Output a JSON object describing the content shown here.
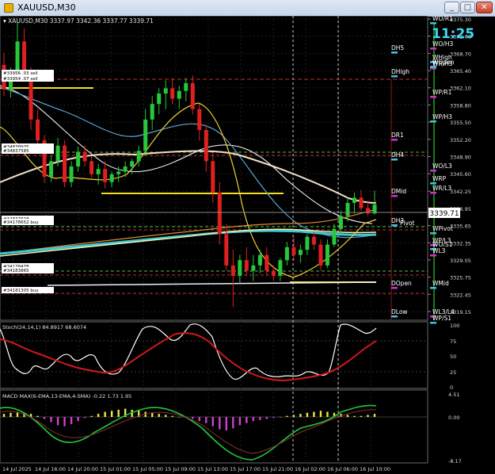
{
  "window": {
    "title": "XAUUSD,M30"
  },
  "header": {
    "symbol": "XAUUSD,M30",
    "ohlc": "3337.97 3342.36 3337.77 3339.71"
  },
  "clock": "11:25",
  "current_price": "3339.71",
  "price_axis": [
    "3375.30",
    "3372.00",
    "3368.70",
    "3365.40",
    "3362.10",
    "3358.80",
    "3355.50",
    "3352.20",
    "3348.90",
    "3345.60",
    "3342.25",
    "3338.95",
    "3335.65",
    "3332.35",
    "3329.05",
    "3325.75",
    "3322.45",
    "3319.15"
  ],
  "pivot_labels": [
    "DH5",
    "DHigh",
    "DR1",
    "DH4",
    "DMid",
    "DH3",
    "DOpen",
    "DLow",
    "Pivot"
  ],
  "weekly_labels": [
    "WO/R1",
    "WO/H3",
    "WHigh",
    "WR/H3",
    "WOpen",
    "WP/R1",
    "WP/H3",
    "WO/L3",
    "WRP",
    "WR/L3",
    "WPivot",
    "WP/L3",
    "WO/S1",
    "WL3",
    "WMid",
    "WL3/L4",
    "WP/S1"
  ],
  "order_tags": [
    "#33956 .03 sell",
    "#33954 .07 sell",
    "#34838935",
    "#34837585",
    "#34837608",
    "#34178652 buy",
    "#34178478",
    "#34183865",
    "#34181305 buy"
  ],
  "stoch": {
    "label": "Stoch(24,14,1) 84.8917 68.6074",
    "levels": [
      "100",
      "75",
      "50",
      "25",
      "0"
    ]
  },
  "macd": {
    "label": "MACD MAX(6-EMA,13-EMA,4-SMA) -0.22 1.73 1.95",
    "levels": [
      "4.51",
      "0.00",
      "-8.17"
    ]
  },
  "time_axis": [
    "14 Jul 2025",
    "14 Jul 16:00",
    "14 Jul 20:00",
    "15 Jul 01:00",
    "15 Jul 05:00",
    "15 Jul 09:00",
    "15 Jul 13:00",
    "15 Jul 17:00",
    "15 Jul 21:00",
    "16 Jul 02:00",
    "16 Jul 06:00",
    "16 Jul 10:00"
  ],
  "candles": [
    [
      3366.5,
      3368.8,
      3360.5,
      3361.8
    ],
    [
      3361.8,
      3366.0,
      3360.2,
      3365.0
    ],
    [
      3365.0,
      3374.8,
      3363.5,
      3371.0
    ],
    [
      3371.0,
      3373.5,
      3364.0,
      3365.0
    ],
    [
      3365.0,
      3366.0,
      3354.0,
      3356.0
    ],
    [
      3356.0,
      3358.0,
      3350.8,
      3352.0
    ],
    [
      3352.0,
      3353.0,
      3343.8,
      3345.0
    ],
    [
      3345.0,
      3349.0,
      3344.0,
      3348.0
    ],
    [
      3348.0,
      3352.5,
      3347.0,
      3351.0
    ],
    [
      3351.0,
      3352.0,
      3343.0,
      3344.0
    ],
    [
      3344.0,
      3348.0,
      3343.0,
      3347.0
    ],
    [
      3347.0,
      3350.8,
      3346.0,
      3349.8
    ],
    [
      3349.8,
      3351.0,
      3347.0,
      3348.0
    ],
    [
      3348.0,
      3349.0,
      3344.8,
      3345.5
    ],
    [
      3345.5,
      3347.5,
      3343.5,
      3346.5
    ],
    [
      3346.5,
      3348.0,
      3342.8,
      3344.0
    ],
    [
      3344.0,
      3346.0,
      3343.0,
      3345.5
    ],
    [
      3345.5,
      3347.0,
      3344.0,
      3346.0
    ],
    [
      3346.0,
      3348.0,
      3345.0,
      3347.0
    ],
    [
      3347.0,
      3348.5,
      3345.5,
      3348.0
    ],
    [
      3348.0,
      3351.0,
      3347.0,
      3350.0
    ],
    [
      3350.0,
      3358.0,
      3349.0,
      3356.0
    ],
    [
      3356.0,
      3360.5,
      3354.0,
      3359.0
    ],
    [
      3359.0,
      3362.0,
      3357.0,
      3361.0
    ],
    [
      3361.0,
      3363.5,
      3358.0,
      3362.0
    ],
    [
      3362.0,
      3364.0,
      3359.0,
      3360.0
    ],
    [
      3360.0,
      3362.5,
      3358.0,
      3361.5
    ],
    [
      3361.5,
      3364.0,
      3359.5,
      3363.0
    ],
    [
      3363.0,
      3364.5,
      3357.0,
      3358.0
    ],
    [
      3358.0,
      3359.0,
      3352.0,
      3354.0
    ],
    [
      3354.0,
      3355.0,
      3346.0,
      3348.0
    ],
    [
      3348.0,
      3349.5,
      3340.0,
      3342.0
    ],
    [
      3342.0,
      3344.0,
      3332.0,
      3334.0
    ],
    [
      3334.0,
      3336.0,
      3327.0,
      3328.0
    ],
    [
      3328.0,
      3331.0,
      3320.0,
      3326.0
    ],
    [
      3326.0,
      3330.0,
      3324.5,
      3329.0
    ],
    [
      3329.0,
      3331.5,
      3326.0,
      3327.0
    ],
    [
      3327.0,
      3330.0,
      3325.0,
      3328.0
    ],
    [
      3328.0,
      3331.0,
      3326.5,
      3330.0
    ],
    [
      3330.0,
      3331.5,
      3326.0,
      3327.0
    ],
    [
      3327.0,
      3328.0,
      3325.0,
      3326.0
    ],
    [
      3326.0,
      3329.5,
      3325.0,
      3329.0
    ],
    [
      3329.0,
      3332.5,
      3328.0,
      3331.5
    ],
    [
      3331.5,
      3333.5,
      3329.0,
      3330.0
    ],
    [
      3330.0,
      3332.0,
      3328.5,
      3331.0
    ],
    [
      3331.0,
      3334.0,
      3330.0,
      3333.5
    ],
    [
      3333.5,
      3334.5,
      3331.0,
      3332.0
    ],
    [
      3332.0,
      3333.0,
      3327.0,
      3328.0
    ],
    [
      3328.0,
      3333.0,
      3327.5,
      3332.0
    ],
    [
      3332.0,
      3336.0,
      3331.5,
      3335.0
    ],
    [
      3335.0,
      3338.5,
      3334.0,
      3337.5
    ],
    [
      3337.5,
      3341.0,
      3336.5,
      3340.0
    ],
    [
      3340.0,
      3342.0,
      3338.0,
      3341.0
    ],
    [
      3341.0,
      3342.5,
      3338.5,
      3339.0
    ],
    [
      3339.0,
      3340.5,
      3337.5,
      3338.0
    ],
    [
      3337.97,
      3342.36,
      3337.77,
      3339.71
    ]
  ],
  "colors": {
    "bull": "#27c83a",
    "bear": "#e02020",
    "stoch_main": "#ffffff",
    "stoch_signal": "#d01818",
    "macd_pos": "#e6e64a",
    "macd_neg": "#d040d0",
    "ma_yellow": "#f0d030",
    "ma_cyan": "#40c8d0",
    "ma_white": "#f0f0f0",
    "ma_orange": "#e08a30",
    "ma_skyblue": "#5aa6d8"
  }
}
